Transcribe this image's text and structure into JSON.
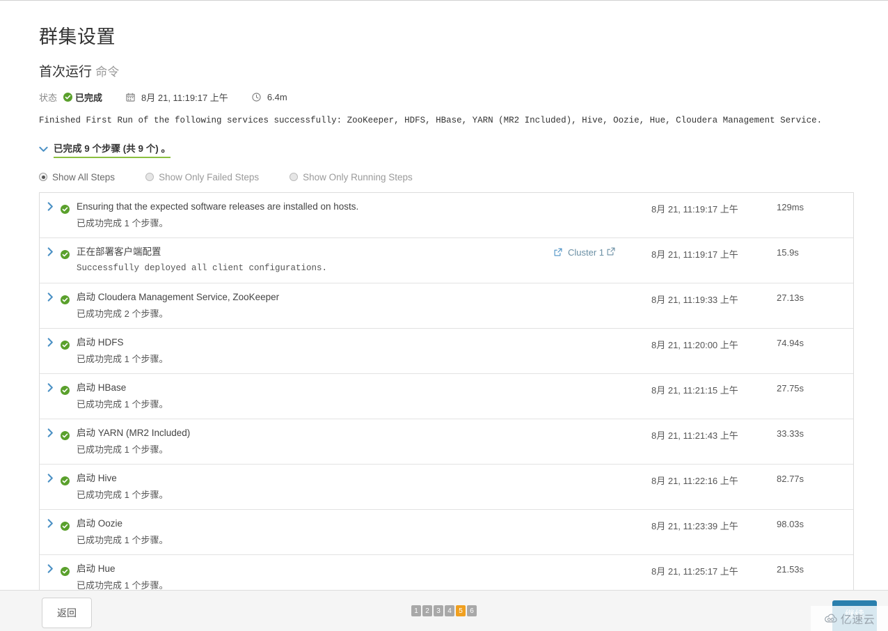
{
  "header": {
    "page_title": "群集设置",
    "command_name": "首次运行",
    "command_suffix": "命令",
    "status_label": "状态",
    "status_value": "已完成",
    "status_icon": "check-circle-icon",
    "calendar_icon": "calendar-icon",
    "started_at": "8月 21, 11:19:17 上午",
    "clock_icon": "clock-icon",
    "duration": "6.4m",
    "description": "Finished First Run of the following services successfully: ZooKeeper, HDFS, HBase, YARN (MR2 Included), Hive, Oozie, Hue, Cloudera Management Service."
  },
  "steps_toggle": {
    "chevron_icon": "chevron-down-icon",
    "label": "已完成 9 个步骤 (共 9 个) 。"
  },
  "filters": {
    "options": [
      {
        "label": "Show All Steps",
        "selected": true
      },
      {
        "label": "Show Only Failed Steps",
        "selected": false
      },
      {
        "label": "Show Only Running Steps",
        "selected": false
      }
    ]
  },
  "steps": [
    {
      "expand_icon": "chevron-right-icon",
      "status_icon": "check-circle-icon",
      "title": "Ensuring that the expected software releases are installed on hosts.",
      "subtitle": "已成功完成 1 个步骤。",
      "subtitle_mono": false,
      "ext_icon": "",
      "link_text": "",
      "link_icon": "",
      "time": "8月 21, 11:19:17 上午",
      "duration": "129ms"
    },
    {
      "expand_icon": "chevron-right-icon",
      "status_icon": "check-circle-icon",
      "title": "正在部署客户端配置",
      "subtitle": "Successfully deployed all client configurations.",
      "subtitle_mono": true,
      "ext_icon": "external-link-icon",
      "link_text": "Cluster 1",
      "link_icon": "external-link-icon",
      "time": "8月 21, 11:19:17 上午",
      "duration": "15.9s"
    },
    {
      "expand_icon": "chevron-right-icon",
      "status_icon": "check-circle-icon",
      "title": "启动 Cloudera Management Service, ZooKeeper",
      "subtitle": "已成功完成 2 个步骤。",
      "subtitle_mono": false,
      "ext_icon": "",
      "link_text": "",
      "link_icon": "",
      "time": "8月 21, 11:19:33 上午",
      "duration": "27.13s"
    },
    {
      "expand_icon": "chevron-right-icon",
      "status_icon": "check-circle-icon",
      "title": "启动 HDFS",
      "subtitle": "已成功完成 1 个步骤。",
      "subtitle_mono": false,
      "ext_icon": "",
      "link_text": "",
      "link_icon": "",
      "time": "8月 21, 11:20:00 上午",
      "duration": "74.94s"
    },
    {
      "expand_icon": "chevron-right-icon",
      "status_icon": "check-circle-icon",
      "title": "启动 HBase",
      "subtitle": "已成功完成 1 个步骤。",
      "subtitle_mono": false,
      "ext_icon": "",
      "link_text": "",
      "link_icon": "",
      "time": "8月 21, 11:21:15 上午",
      "duration": "27.75s"
    },
    {
      "expand_icon": "chevron-right-icon",
      "status_icon": "check-circle-icon",
      "title": "启动 YARN (MR2 Included)",
      "subtitle": "已成功完成 1 个步骤。",
      "subtitle_mono": false,
      "ext_icon": "",
      "link_text": "",
      "link_icon": "",
      "time": "8月 21, 11:21:43 上午",
      "duration": "33.33s"
    },
    {
      "expand_icon": "chevron-right-icon",
      "status_icon": "check-circle-icon",
      "title": "启动 Hive",
      "subtitle": "已成功完成 1 个步骤。",
      "subtitle_mono": false,
      "ext_icon": "",
      "link_text": "",
      "link_icon": "",
      "time": "8月 21, 11:22:16 上午",
      "duration": "82.77s"
    },
    {
      "expand_icon": "chevron-right-icon",
      "status_icon": "check-circle-icon",
      "title": "启动 Oozie",
      "subtitle": "已成功完成 1 个步骤。",
      "subtitle_mono": false,
      "ext_icon": "",
      "link_text": "",
      "link_icon": "",
      "time": "8月 21, 11:23:39 上午",
      "duration": "98.03s"
    },
    {
      "expand_icon": "chevron-right-icon",
      "status_icon": "check-circle-icon",
      "title": "启动 Hue",
      "subtitle": "已成功完成 1 个步骤。",
      "subtitle_mono": false,
      "ext_icon": "",
      "link_text": "",
      "link_icon": "",
      "time": "8月 21, 11:25:17 上午",
      "duration": "21.53s"
    }
  ],
  "footer": {
    "back_label": "返回",
    "continue_label": "继续",
    "pages": [
      "1",
      "2",
      "3",
      "4",
      "5",
      "6"
    ],
    "active_page": "5"
  },
  "watermark": {
    "text": "亿速云",
    "logo_icon": "cloud-logo-icon"
  },
  "colors": {
    "success_green": "#5aa02c",
    "accent_blue": "#4a90c4",
    "underline_green": "#8bbf3f",
    "pager_active": "#f0a020",
    "primary_button": "#2a7fad"
  }
}
